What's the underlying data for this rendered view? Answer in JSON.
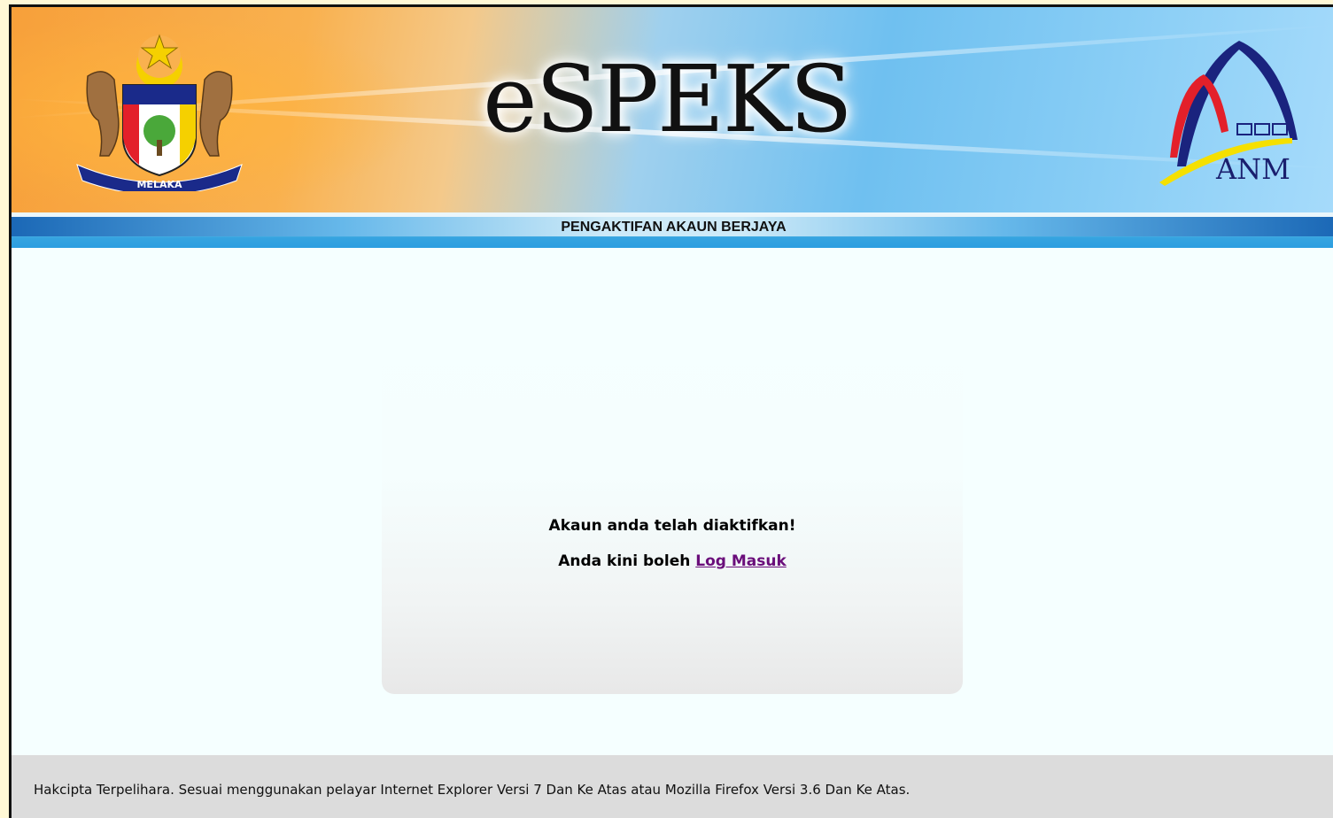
{
  "header": {
    "title": "eSPEKS",
    "left_logo": {
      "icon": "melaka-crest-icon",
      "motto": "MELAKA"
    },
    "right_logo": {
      "icon": "anm-logo-icon",
      "label": "ANM"
    }
  },
  "status_bar": {
    "text": "PENGAKTIFAN AKAUN BERJAYA"
  },
  "message": {
    "line1": "Akaun anda telah diaktifkan!",
    "line2_prefix": "Anda kini boleh ",
    "login_link": "Log Masuk"
  },
  "footer": {
    "text": "Hakcipta Terpelihara. Sesuai menggunakan pelayar Internet Explorer Versi 7 Dan Ke Atas atau Mozilla Firefox Versi 3.6 Dan Ke Atas."
  },
  "colors": {
    "banner_orange": "#f7a03a",
    "banner_blue": "#6fc0f0",
    "bar_blue": "#1a66b4",
    "link": "#6a0d7a",
    "footer_bg": "#dcdcdc"
  }
}
